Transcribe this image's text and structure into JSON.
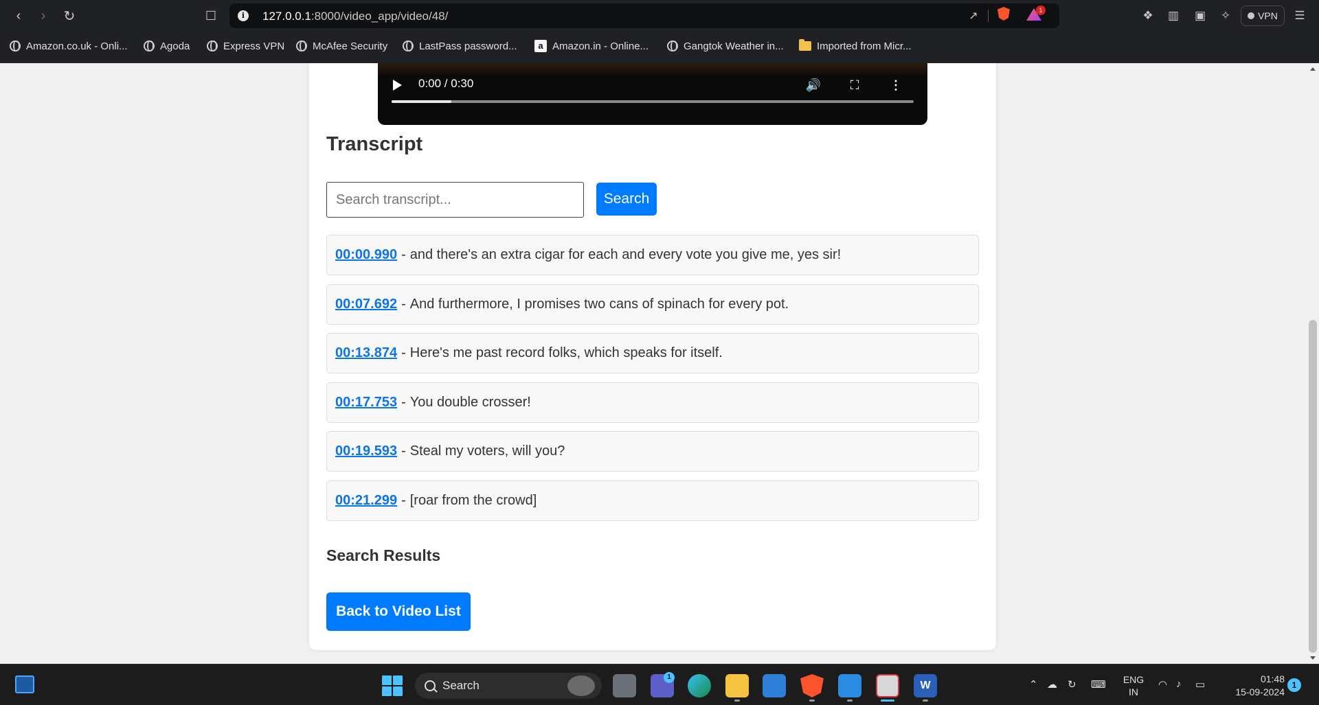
{
  "browser": {
    "url": "127.0.0.1:8000/video_app/video/48/",
    "url_host": "127.0.0.1",
    "url_rest": ":8000/video_app/video/48/",
    "rewards_badge": "1",
    "vpn_label": "VPN",
    "bookmarks": [
      {
        "label": "Amazon.co.uk - Onli...",
        "icon": "globe-icon"
      },
      {
        "label": "Agoda",
        "icon": "globe-icon"
      },
      {
        "label": "Express VPN",
        "icon": "globe-icon"
      },
      {
        "label": "McAfee Security",
        "icon": "globe-icon"
      },
      {
        "label": "LastPass password...",
        "icon": "globe-icon"
      },
      {
        "label": "Amazon.in - Online...",
        "icon": "amazon-icon"
      },
      {
        "label": "Gangtok Weather in...",
        "icon": "globe-icon"
      },
      {
        "label": "Imported from Micr...",
        "icon": "folder-icon"
      }
    ]
  },
  "video": {
    "time_display": "0:00 / 0:30",
    "buffered_fraction": 0.115
  },
  "transcript": {
    "title": "Transcript",
    "search_placeholder": "Search transcript...",
    "search_value": "",
    "search_button": "Search",
    "separator": "-",
    "lines": [
      {
        "timestamp": "00:00.990",
        "text": "and there's an extra cigar for each and every vote you give me, yes sir!"
      },
      {
        "timestamp": "00:07.692",
        "text": "And furthermore, I promises two cans of spinach for every pot."
      },
      {
        "timestamp": "00:13.874",
        "text": "Here's me past record folks, which speaks for itself."
      },
      {
        "timestamp": "00:17.753",
        "text": "You double crosser!"
      },
      {
        "timestamp": "00:19.593",
        "text": "Steal my voters, will you?"
      },
      {
        "timestamp": "00:21.299",
        "text": "[roar from the crowd]"
      }
    ],
    "results_title": "Search Results",
    "back_button": "Back to Video List"
  },
  "taskbar": {
    "search_label": "Search",
    "teams_badge": "1",
    "word_glyph": "W",
    "language_line1": "ENG",
    "language_line2": "IN",
    "time": "01:48",
    "date": "15-09-2024",
    "notification_count": "1"
  },
  "colors": {
    "accent": "#007bff",
    "link": "#0a74e8",
    "chrome_bg": "#202124",
    "taskbar_bg": "#1c1c1c"
  }
}
